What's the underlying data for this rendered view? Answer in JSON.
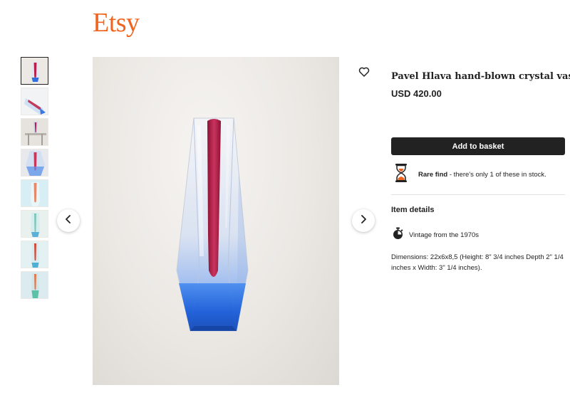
{
  "header": {
    "logo_text": "Etsy",
    "brand_color": "#F1641E"
  },
  "gallery": {
    "thumbnails": [
      {
        "alt": "thumbnail-1",
        "active": true
      },
      {
        "alt": "thumbnail-2",
        "active": false
      },
      {
        "alt": "thumbnail-3",
        "active": false
      },
      {
        "alt": "thumbnail-4",
        "active": false
      },
      {
        "alt": "thumbnail-5",
        "active": false
      },
      {
        "alt": "thumbnail-6",
        "active": false
      },
      {
        "alt": "thumbnail-7",
        "active": false
      },
      {
        "alt": "thumbnail-8",
        "active": false
      }
    ],
    "prev_icon": "chevron-left-icon",
    "next_icon": "chevron-right-icon"
  },
  "listing": {
    "title": "Pavel Hlava hand-blown crystal vase",
    "price": "USD 420.00",
    "favorite_icon": "heart-icon",
    "add_to_basket": "Add to basket",
    "rare_find_label": "Rare find",
    "rare_find_text": " - there's only 1 of these in stock.",
    "rare_find_icon": "hourglass-icon"
  },
  "item_details": {
    "heading": "Item details",
    "vintage_icon": "stopwatch-icon",
    "vintage_text": "Vintage from the 1970s",
    "dimensions": "Dimensions: 22x6x8,5 (Height: 8\" 3/4 inches Depth 2\" 1/4 inches x Width: 3\" 1/4 inches)."
  },
  "colors": {
    "button_bg": "#222222",
    "divider": "#e1e1e1",
    "glass_blue": "#2f6fe0",
    "glass_red": "#b81f4a"
  }
}
